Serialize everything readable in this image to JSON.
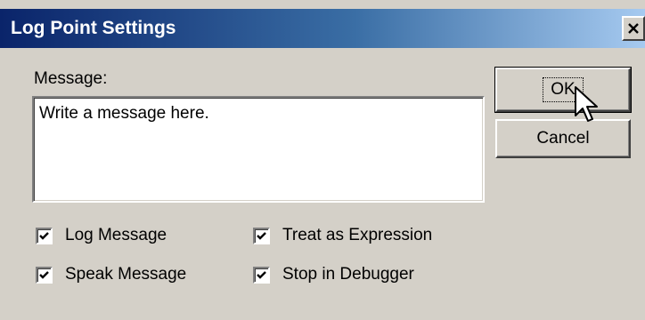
{
  "window": {
    "title": "Log Point Settings",
    "close_glyph": "✕"
  },
  "message": {
    "label": "Message:",
    "value": "Write a message here."
  },
  "buttons": {
    "ok": "OK",
    "cancel": "Cancel"
  },
  "options": [
    {
      "label": "Log Message",
      "checked": true
    },
    {
      "label": "Treat as Expression",
      "checked": true
    },
    {
      "label": "Speak Message",
      "checked": true
    },
    {
      "label": "Stop in Debugger",
      "checked": true
    }
  ],
  "colors": {
    "face": "#d4d0c8",
    "title_start": "#0a246a",
    "title_end": "#a6caf0"
  }
}
